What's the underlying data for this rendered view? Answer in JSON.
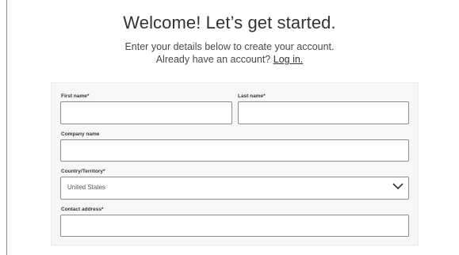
{
  "header": {
    "title": "Welcome! Let’s get started.",
    "subtitle": "Enter your details below to create your account.",
    "login_prompt": "Already have an account?",
    "login_link": "Log in."
  },
  "form": {
    "first_name": {
      "label": "First name*",
      "value": ""
    },
    "last_name": {
      "label": "Last name*",
      "value": ""
    },
    "company": {
      "label": "Company name",
      "value": ""
    },
    "country": {
      "label": "Country/Territory*",
      "selected": "United States"
    },
    "address": {
      "label": "Contact address*",
      "value": ""
    }
  },
  "icons": {
    "dropdown": "chevron-down-icon"
  }
}
